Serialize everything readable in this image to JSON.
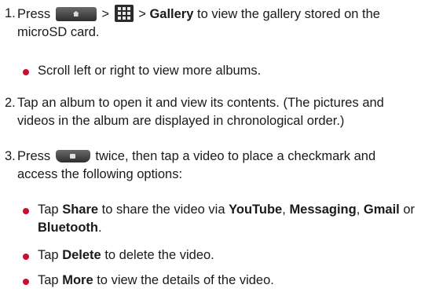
{
  "steps": [
    {
      "number": "1.",
      "press": "Press",
      "sep1": ">",
      "sep2": ">",
      "gallery": "Gallery",
      "rest": "to view the gallery stored on the microSD card.",
      "home_key_icon": "home-key-icon",
      "apps_icon": "apps-grid-icon"
    },
    {
      "number": "2.",
      "text": "Tap an album to open it and view its contents. (The pictures and videos in the album are displayed in chronological order.)"
    },
    {
      "number": "3.",
      "press": "Press",
      "rest": "twice, then tap a video to place a checkmark and access the following options:",
      "menu_key_icon": "menu-key-icon"
    }
  ],
  "bullets": [
    {
      "text": "Scroll left or right to view more albums."
    },
    {
      "tap": "Tap",
      "share": "Share",
      "mid": "to share the video via",
      "youtube": "YouTube",
      "comma1": ",",
      "messaging": "Messaging",
      "comma2": ",",
      "gmail": "Gmail",
      "or": "or",
      "bluetooth": "Bluetooth",
      "end": "."
    },
    {
      "tap": "Tap",
      "delete": "Delete",
      "rest": "to delete the video."
    },
    {
      "tap": "Tap",
      "more": "More",
      "rest": "to view the details of the video."
    }
  ],
  "colors": {
    "bullet": "#c8102e",
    "text": "#1a1a1a"
  }
}
